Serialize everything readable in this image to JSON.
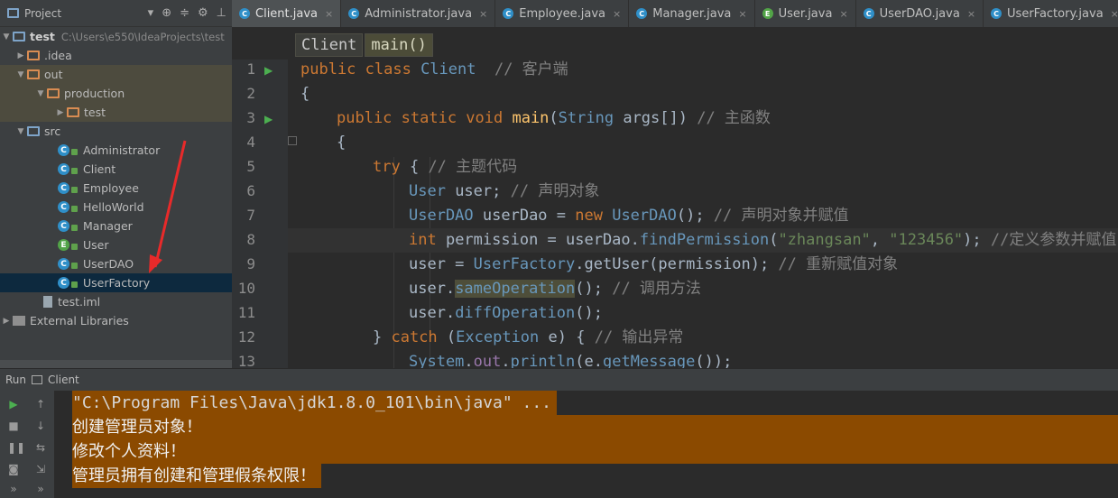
{
  "project": {
    "title": "Project",
    "tree": [
      {
        "label": "test",
        "path": "C:\\Users\\e550\\IdeaProjects\\test"
      },
      {
        "label": ".idea"
      },
      {
        "label": "out"
      },
      {
        "label": "production"
      },
      {
        "label": "test"
      },
      {
        "label": "src"
      },
      {
        "label": "Administrator"
      },
      {
        "label": "Client"
      },
      {
        "label": "Employee"
      },
      {
        "label": "HelloWorld"
      },
      {
        "label": "Manager"
      },
      {
        "label": "User"
      },
      {
        "label": "UserDAO"
      },
      {
        "label": "UserFactory"
      },
      {
        "label": "test.iml"
      },
      {
        "label": "External Libraries"
      }
    ]
  },
  "tabs": [
    "Client.java",
    "Administrator.java",
    "Employee.java",
    "Manager.java",
    "User.java",
    "UserDAO.java",
    "UserFactory.java"
  ],
  "active_tab": 0,
  "breadcrumb": [
    "Client",
    "main()"
  ],
  "line_numbers": [
    "1",
    "2",
    "3",
    "4",
    "5",
    "6",
    "7",
    "8",
    "9",
    "10",
    "11",
    "12",
    "13"
  ],
  "code": {
    "l1_kw": "public class ",
    "l1_cls": "Client",
    "l1_cm": "  // 客户端",
    "l2": "{",
    "l3_kw": "public static void ",
    "l3_mt": "main",
    "l3_a": "(",
    "l3_ty": "String",
    "l3_b": " args[]) ",
    "l3_cm": "// 主函数",
    "l4": "{",
    "l5_kw": "try",
    "l5_a": " { ",
    "l5_cm": "// 主题代码",
    "l6_ty": "User",
    "l6_a": " user; ",
    "l6_cm": "// 声明对象",
    "l7_ty": "UserDAO",
    "l7_a": " userDao = ",
    "l7_kw": "new ",
    "l7_ty2": "UserDAO",
    "l7_b": "(); ",
    "l7_cm": "// 声明对象并赋值",
    "l8_kw": "int",
    "l8_a": " permission = userDao.",
    "l8_fn": "findPermission",
    "l8_b": "(",
    "l8_s1": "\"zhangsan\"",
    "l8_c": ", ",
    "l8_s2": "\"123456\"",
    "l8_d": "); ",
    "l8_cm": "//定义参数并赋值",
    "l9_a": "user = ",
    "l9_ty": "UserFactory",
    "l9_b": ".getUser(permission); ",
    "l9_cm": "// 重新赋值对象",
    "l10_a": "user.",
    "l10_fn": "sameOperation",
    "l10_b": "(); ",
    "l10_cm": "// 调用方法",
    "l11_a": "user.",
    "l11_fn": "diffOperation",
    "l11_b": "();",
    "l12_a": "} ",
    "l12_kw": "catch",
    "l12_b": " (",
    "l12_ty": "Exception",
    "l12_c": " e) { ",
    "l12_cm": "// 输出异常",
    "l13_ty": "System",
    "l13_a": ".",
    "l13_fn": "out",
    "l13_b": ".",
    "l13_fn2": "println",
    "l13_c": "(e.",
    "l13_fn3": "getMessage",
    "l13_d": "());"
  },
  "run": {
    "label": "Run",
    "config": "Client"
  },
  "console": [
    "\"C:\\Program Files\\Java\\jdk1.8.0_101\\bin\\java\" ...",
    "创建管理员对象！",
    "修改个人资料！",
    "管理员拥有创建和管理假条权限！"
  ]
}
